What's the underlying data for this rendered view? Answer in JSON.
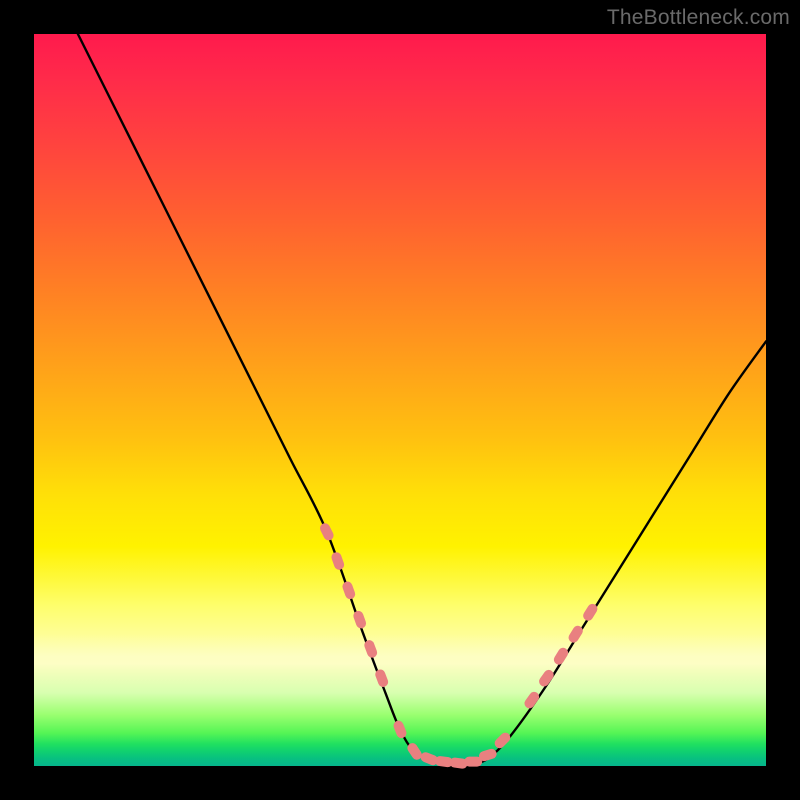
{
  "watermark": "TheBottleneck.com",
  "chart_data": {
    "type": "line",
    "title": "",
    "xlabel": "",
    "ylabel": "",
    "xlim": [
      0,
      100
    ],
    "ylim": [
      0,
      100
    ],
    "grid": false,
    "legend": false,
    "background_gradient_stops": [
      {
        "pos": 0,
        "color": "#ff1a4d"
      },
      {
        "pos": 25,
        "color": "#ff6030"
      },
      {
        "pos": 55,
        "color": "#ffc010"
      },
      {
        "pos": 70,
        "color": "#fff200"
      },
      {
        "pos": 86,
        "color": "#fdfec0"
      },
      {
        "pos": 95,
        "color": "#55f555"
      },
      {
        "pos": 100,
        "color": "#05b58c"
      }
    ],
    "series": [
      {
        "name": "bottleneck-curve",
        "color": "#000000",
        "x": [
          6,
          10,
          15,
          20,
          25,
          30,
          35,
          40,
          45,
          48,
          50,
          52,
          55,
          58,
          60,
          62,
          65,
          70,
          75,
          80,
          85,
          90,
          95,
          100
        ],
        "y": [
          100,
          92,
          82,
          72,
          62,
          52,
          42,
          32,
          18,
          10,
          5,
          2,
          0.8,
          0.4,
          0.4,
          1,
          4,
          11,
          19,
          27,
          35,
          43,
          51,
          58
        ]
      }
    ],
    "highlight_segments": [
      {
        "name": "left-shoulder-dots",
        "color": "#e98080",
        "points": [
          {
            "x": 40,
            "y": 32
          },
          {
            "x": 41.5,
            "y": 28
          },
          {
            "x": 43,
            "y": 24
          },
          {
            "x": 44.5,
            "y": 20
          },
          {
            "x": 46,
            "y": 16
          },
          {
            "x": 47.5,
            "y": 12
          }
        ]
      },
      {
        "name": "valley-dots",
        "color": "#e98080",
        "points": [
          {
            "x": 50,
            "y": 5
          },
          {
            "x": 52,
            "y": 2
          },
          {
            "x": 54,
            "y": 1
          },
          {
            "x": 56,
            "y": 0.6
          },
          {
            "x": 58,
            "y": 0.4
          },
          {
            "x": 60,
            "y": 0.6
          },
          {
            "x": 62,
            "y": 1.5
          },
          {
            "x": 64,
            "y": 3.5
          }
        ]
      },
      {
        "name": "right-shoulder-dots",
        "color": "#e98080",
        "points": [
          {
            "x": 68,
            "y": 9
          },
          {
            "x": 70,
            "y": 12
          },
          {
            "x": 72,
            "y": 15
          },
          {
            "x": 74,
            "y": 18
          },
          {
            "x": 76,
            "y": 21
          }
        ]
      }
    ]
  }
}
